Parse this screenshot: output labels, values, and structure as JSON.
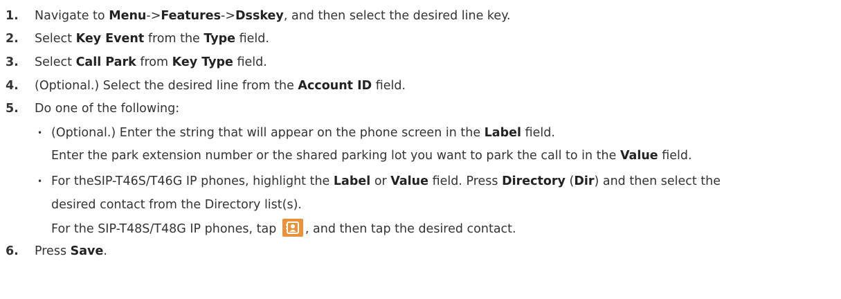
{
  "steps": [
    {
      "num": "1.",
      "parts": [
        "Navigate to ",
        "Menu",
        "->",
        "Features",
        "->",
        "Dsskey",
        ", and then select the desired line key."
      ]
    },
    {
      "num": "2.",
      "parts": [
        "Select ",
        "Key Event",
        " from the ",
        "Type",
        " field."
      ]
    },
    {
      "num": "3.",
      "parts": [
        "Select ",
        "Call Park",
        " from ",
        "Key Type",
        " field."
      ]
    },
    {
      "num": "4.",
      "parts": [
        "(Optional.) Select the desired line from the ",
        "Account ID",
        " field."
      ]
    },
    {
      "num": "5.",
      "parts": [
        "Do one of the following:"
      ]
    },
    {
      "num": "6.",
      "parts": [
        "Press ",
        "Save",
        "."
      ]
    }
  ],
  "bullets": [
    {
      "line1": [
        "(Optional.) Enter the string that will appear on the phone screen in the ",
        "Label",
        " field."
      ],
      "line2": [
        "Enter the park extension number or the shared parking lot you want to park the call to in the ",
        "Value",
        " field."
      ]
    },
    {
      "line1": [
        "For theSIP-T46S/T46G IP phones, highlight the ",
        "Label",
        " or ",
        "Value",
        " field. Press ",
        "Directory",
        " (",
        "Dir",
        ") and then select the"
      ],
      "line2": [
        "desired contact from the Directory list(s)."
      ],
      "line3": [
        "For the SIP-T48S/T48G IP phones, tap ",
        ", and then tap the desired contact."
      ]
    }
  ],
  "bullet_char": "•",
  "icon": "directory-contact-icon",
  "icon_color": "#e8923a"
}
